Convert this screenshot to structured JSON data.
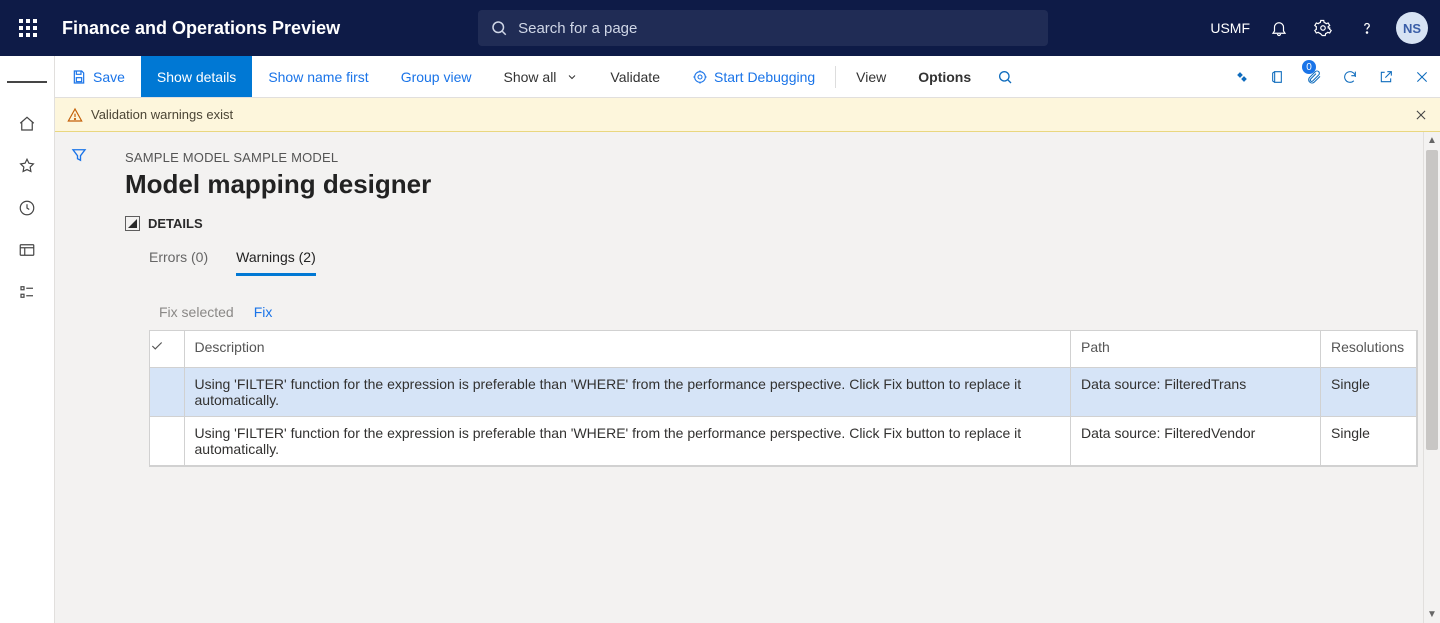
{
  "topbar": {
    "app_title": "Finance and Operations Preview",
    "search_placeholder": "Search for a page",
    "company": "USMF",
    "user_initials": "NS"
  },
  "actionbar": {
    "save": "Save",
    "show_details": "Show details",
    "show_name_first": "Show name first",
    "group_view": "Group view",
    "show_all": "Show all",
    "validate": "Validate",
    "start_debugging": "Start Debugging",
    "view": "View",
    "options": "Options",
    "attachment_badge": "0"
  },
  "banner": {
    "message": "Validation warnings exist"
  },
  "page": {
    "breadcrumb": "SAMPLE MODEL SAMPLE MODEL",
    "title": "Model mapping designer",
    "details_label": "DETAILS"
  },
  "tabs": {
    "errors": {
      "label": "Errors (0)"
    },
    "warnings": {
      "label": "Warnings (2)"
    }
  },
  "grid_toolbar": {
    "fix_selected": "Fix selected",
    "fix": "Fix"
  },
  "grid": {
    "headers": {
      "description": "Description",
      "path": "Path",
      "resolutions": "Resolutions"
    },
    "rows": [
      {
        "description": "Using 'FILTER' function for the expression is preferable than 'WHERE' from the performance perspective. Click Fix button to replace it automatically.",
        "path": "Data source: FilteredTrans",
        "resolutions": "Single"
      },
      {
        "description": "Using 'FILTER' function for the expression is preferable than 'WHERE' from the performance perspective. Click Fix button to replace it automatically.",
        "path": "Data source: FilteredVendor",
        "resolutions": "Single"
      }
    ]
  }
}
